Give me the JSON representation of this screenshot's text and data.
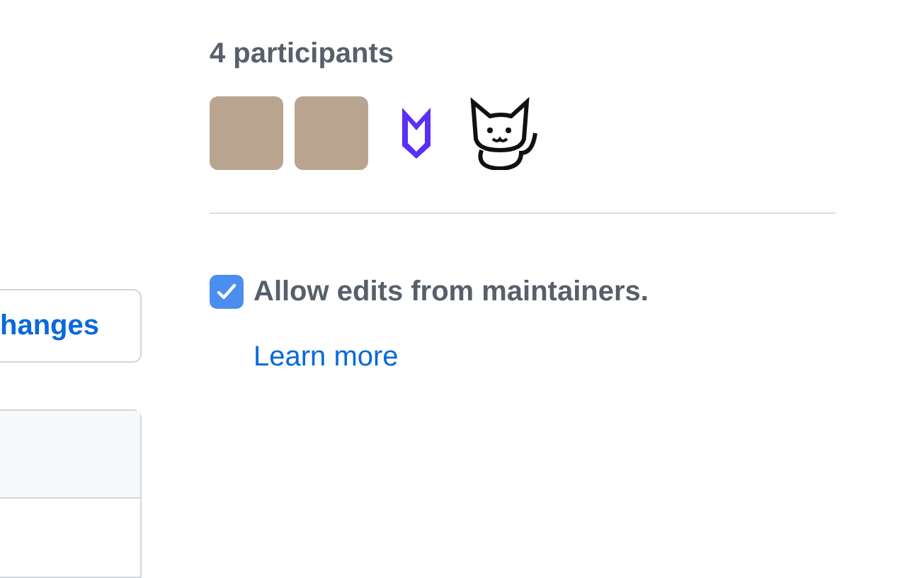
{
  "left_button": {
    "label": "hanges"
  },
  "participants": {
    "title": "4 participants",
    "avatars": [
      {
        "kind": "photo"
      },
      {
        "kind": "photo"
      },
      {
        "kind": "logo"
      },
      {
        "kind": "cat"
      }
    ]
  },
  "allow_edits": {
    "label": "Allow edits from maintainers.",
    "checked": true
  },
  "learn_more": "Learn more"
}
